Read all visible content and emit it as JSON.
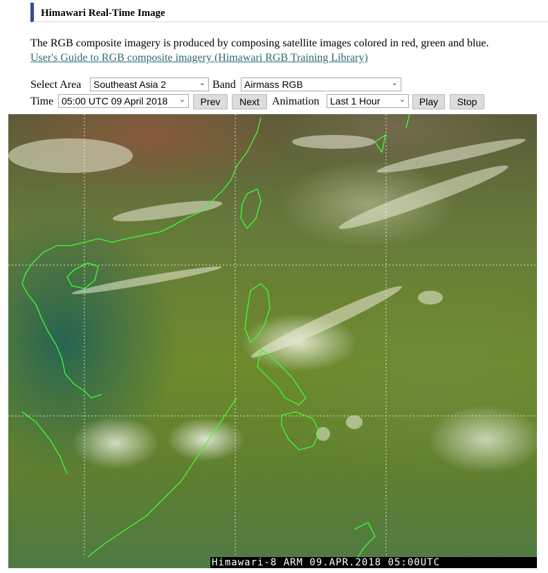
{
  "header": {
    "title": "Himawari Real-Time Image"
  },
  "description": "The RGB composite imagery is produced by composing satellite images colored in red, green and blue.",
  "guide_link": "User's Guide to RGB composite imagery (Himawari RGB Training Library)",
  "controls": {
    "area_label": "Select Area",
    "area_value": "Southeast Asia 2",
    "band_label": "Band",
    "band_value": "Airmass RGB",
    "time_label": "Time",
    "time_value": "05:00 UTC 09 April 2018",
    "prev_label": "Prev",
    "next_label": "Next",
    "animation_label": "Animation",
    "animation_value": "Last 1 Hour",
    "play_label": "Play",
    "stop_label": "Stop"
  },
  "image": {
    "caption": "Himawari-8  ARM 09.APR.2018 05:00UTC",
    "coastline_color": "#39ff39",
    "grid_color": "#ffffff"
  },
  "colors": {
    "accent": "#2e4d93",
    "link": "#2d6a73"
  }
}
